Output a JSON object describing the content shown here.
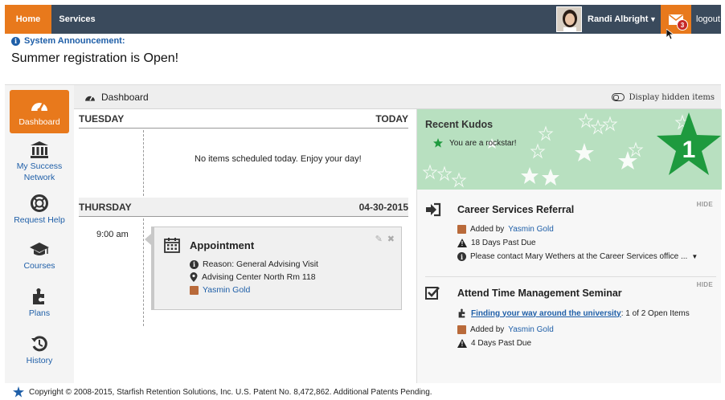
{
  "nav": {
    "home": "Home",
    "services": "Services",
    "user_name": "Randi Albright",
    "mail_count": "3",
    "logout": "logout"
  },
  "announcement": {
    "heading": "System Announcement:",
    "text": "Summer registration is Open!"
  },
  "sidebar": {
    "items": [
      {
        "label": "Dashboard",
        "icon": "speedometer-icon",
        "active": true
      },
      {
        "label": "My Success Network",
        "icon": "institution-icon"
      },
      {
        "label": "Request Help",
        "icon": "lifebuoy-icon"
      },
      {
        "label": "Courses",
        "icon": "graduation-cap-icon"
      },
      {
        "label": "Plans",
        "icon": "puzzle-icon"
      },
      {
        "label": "History",
        "icon": "history-icon"
      }
    ]
  },
  "dashboard": {
    "title": "Dashboard",
    "display_hidden": "Display hidden items"
  },
  "calendar": {
    "day1": {
      "name": "TUESDAY",
      "tag": "TODAY",
      "empty_text": "No items scheduled today. Enjoy your day!"
    },
    "day2": {
      "name": "THURSDAY",
      "tag": "04-30-2015"
    },
    "appointment": {
      "time": "9:00 am",
      "title": "Appointment",
      "reason": "Reason: General Advising Visit",
      "location": "Advising Center North Rm 118",
      "person": "Yasmin Gold"
    }
  },
  "kudos": {
    "title": "Recent Kudos",
    "item": "You are a rockstar!",
    "count": "1",
    "accent": "#1e9a3e"
  },
  "tasks": [
    {
      "title": "Career Services Referral",
      "hide": "HIDE",
      "added_prefix": "Added by",
      "added_by": "Yasmin Gold",
      "due": "18 Days Past Due",
      "note": "Please contact Mary Wethers at the Career Services office ..."
    },
    {
      "title": "Attend Time Management Seminar",
      "hide": "HIDE",
      "link_text": "Finding your way around the university",
      "link_suffix": ": 1 of 2 Open Items",
      "added_prefix": "Added by",
      "added_by": "Yasmin Gold",
      "due": "4 Days Past Due"
    }
  ],
  "footer": {
    "text": "Copyright © 2008-2015, Starfish Retention Solutions, Inc. U.S. Patent No. 8,472,862. Additional Patents Pending."
  },
  "colors": {
    "nav_bg": "#3a4a5c",
    "accent_orange": "#e8791c",
    "link_blue": "#1f5fa8"
  }
}
